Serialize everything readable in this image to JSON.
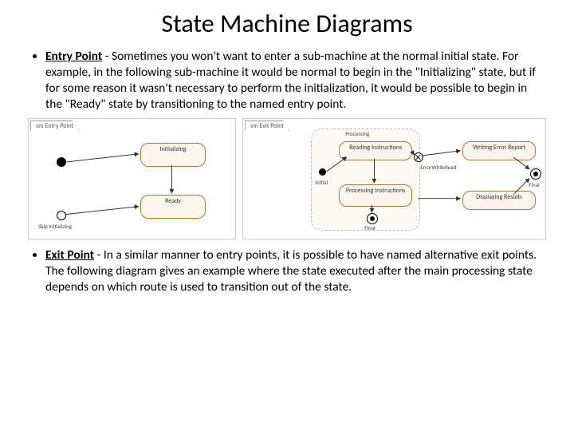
{
  "title": "State Machine Diagrams",
  "bullets": {
    "entry": {
      "term": "Entry Point",
      "text": " - Sometimes you won't want to enter a sub-machine at the normal initial state. For example, in the following sub-machine it would be normal to begin in the \"Initializing\" state, but if for some reason it wasn't necessary to perform the initialization, it would be possible to begin in the \"Ready\" state by transitioning to the named entry point."
    },
    "exit": {
      "term": "Exit Point",
      "text": " - In a similar manner to entry points, it is possible to have named alternative exit points. The following diagram gives an example where the state executed after the main processing state depends on which route is used to transition out of the state."
    }
  },
  "diagLeft": {
    "tab": "sm Entry Point",
    "initializing": "Initializing",
    "ready": "Ready",
    "skip": "Skip Initializing"
  },
  "diagRight": {
    "tab": "sm Exit Point",
    "processing": "Processing",
    "reading": "Reading Instructions",
    "procInstr": "Processing Instructions",
    "writing": "Writing Error Report",
    "displaying": "Displaying Results",
    "initial": "Initial",
    "final": "Final",
    "finalR": "Final",
    "errRead": "ErrorWhileRead"
  }
}
